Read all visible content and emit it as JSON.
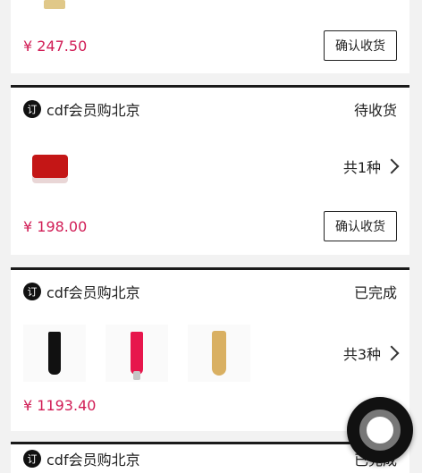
{
  "orders": [
    {
      "price": "¥ 247.50",
      "action": "确认收货"
    },
    {
      "shop": "cdf会员购北京",
      "status": "待收货",
      "count": "共1种",
      "price": "¥ 198.00",
      "action": "确认收货"
    },
    {
      "shop": "cdf会员购北京",
      "status": "已完成",
      "count": "共3种",
      "price": "¥ 1193.40"
    },
    {
      "shop": "cdf会员购北京",
      "status": "已完成"
    }
  ],
  "icons": {
    "shop_icon_glyph": "订"
  }
}
